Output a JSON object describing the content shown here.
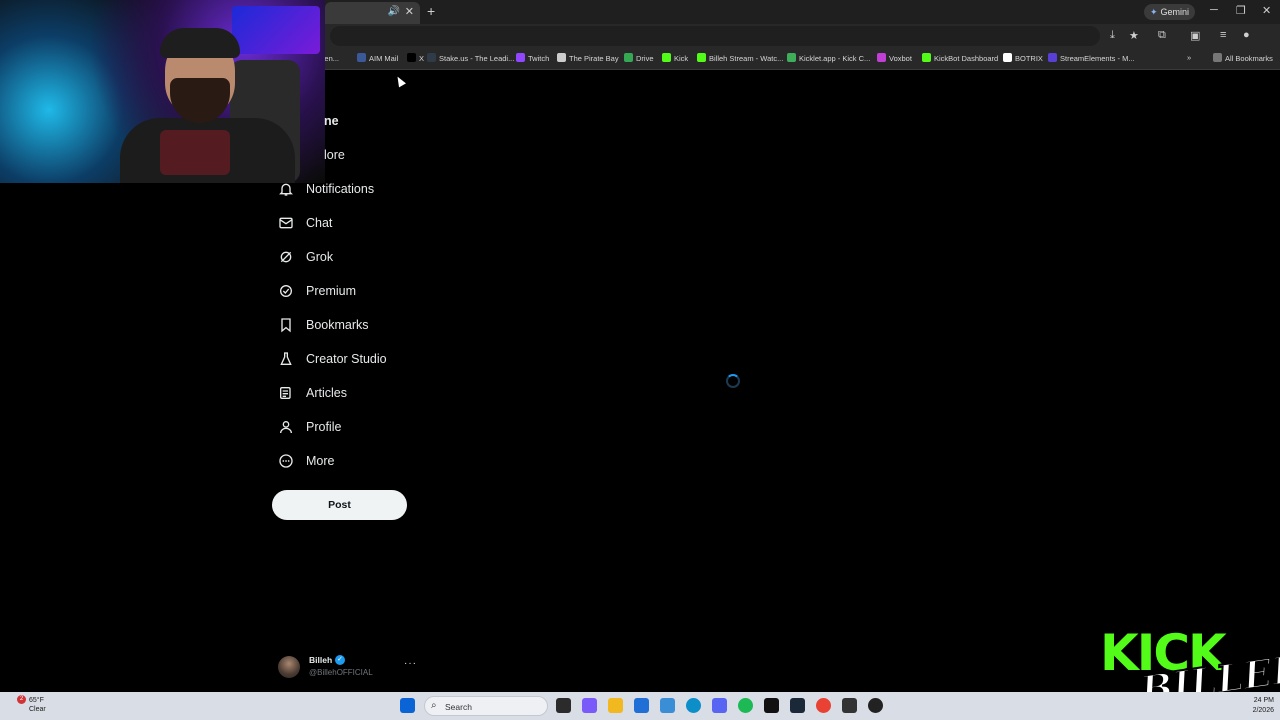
{
  "browser": {
    "gemini_label": "Gemini",
    "bookmarks": [
      {
        "label": "...pen...",
        "color": "#888888"
      },
      {
        "label": "AIM Mail",
        "color": "#3b5998"
      },
      {
        "label": "X",
        "color": "#000000"
      },
      {
        "label": "Stake.us - The Leadi...",
        "color": "#2f3b47"
      },
      {
        "label": "Twitch",
        "color": "#9146ff"
      },
      {
        "label": "The Pirate Bay",
        "color": "#cccccc"
      },
      {
        "label": "Drive",
        "color": "#34a853"
      },
      {
        "label": "Kick",
        "color": "#53fc18"
      },
      {
        "label": "Billeh Stream - Watc...",
        "color": "#53fc18"
      },
      {
        "label": "Kicklet.app - Kick C...",
        "color": "#3fae5a"
      },
      {
        "label": "Voxbot",
        "color": "#c23fd6"
      },
      {
        "label": "KickBot Dashboard",
        "color": "#53fc18"
      },
      {
        "label": "BOTRIX",
        "color": "#ffffff"
      },
      {
        "label": "StreamElements - M...",
        "color": "#5a3fd6"
      }
    ],
    "all_bookmarks": "All Bookmarks"
  },
  "nav": {
    "items": [
      {
        "label": "ne",
        "icon": "home-icon"
      },
      {
        "label": "lore",
        "icon": "explore-icon"
      },
      {
        "label": "Notifications",
        "icon": "bell-icon"
      },
      {
        "label": "Chat",
        "icon": "mail-icon"
      },
      {
        "label": "Grok",
        "icon": "grok-icon"
      },
      {
        "label": "Premium",
        "icon": "premium-icon"
      },
      {
        "label": "Bookmarks",
        "icon": "bookmark-icon"
      },
      {
        "label": "Creator Studio",
        "icon": "flask-icon"
      },
      {
        "label": "Articles",
        "icon": "article-icon"
      },
      {
        "label": "Profile",
        "icon": "person-icon"
      },
      {
        "label": "More",
        "icon": "more-circle-icon"
      }
    ],
    "post_label": "Post"
  },
  "account": {
    "name": "Billeh",
    "handle": "@BillehOFFICIAL",
    "more": "···"
  },
  "overlay": {
    "kick": "KICK",
    "billeh": "BILLEH"
  },
  "taskbar": {
    "weather_temp": "65°F",
    "weather_cond": "Clear",
    "weather_badge": "2",
    "search_label": "Search",
    "time": "24 PM",
    "date": "2/2026"
  },
  "colors": {
    "accent": "#1d9bf0",
    "kick_green": "#53fc18"
  }
}
